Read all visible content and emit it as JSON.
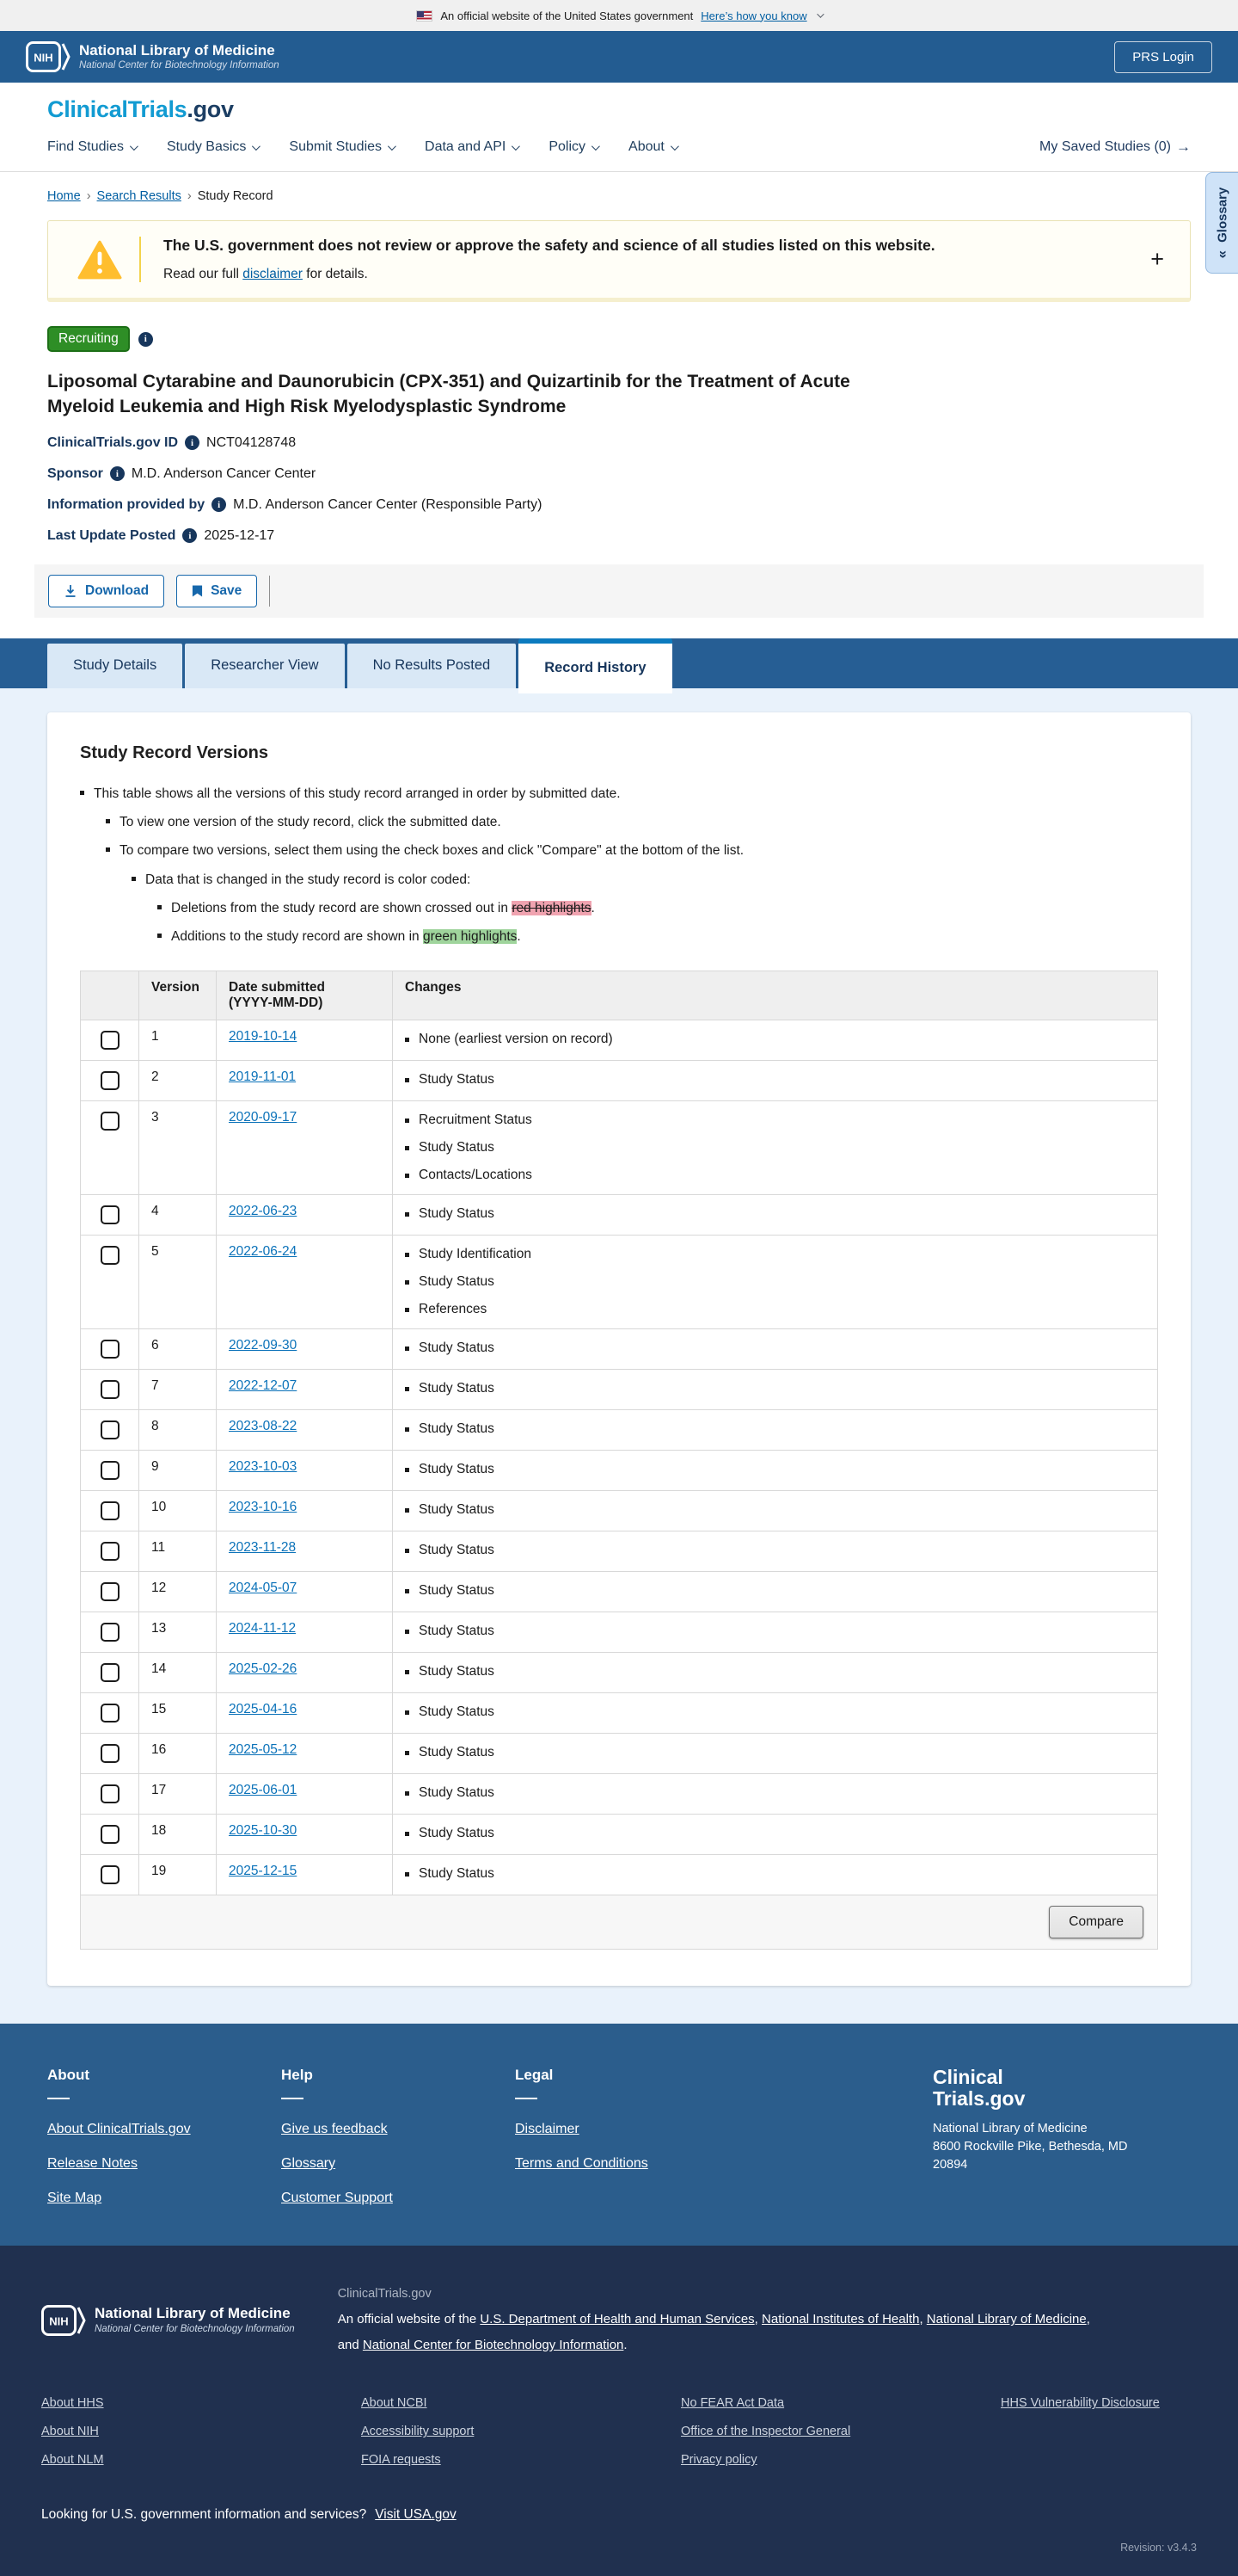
{
  "banner": {
    "text": "An official website of the United States government",
    "link": "Here’s how you know"
  },
  "header": {
    "nih_acronym": "NIH",
    "org": "National Library of Medicine",
    "org_sub": "National Center for Biotechnology Information",
    "login_button": "PRS Login"
  },
  "nav": {
    "logo_primary": "ClinicalTrials",
    "logo_suffix": ".gov",
    "items": [
      {
        "label": "Find Studies"
      },
      {
        "label": "Study Basics"
      },
      {
        "label": "Submit Studies"
      },
      {
        "label": "Data and API"
      },
      {
        "label": "Policy"
      },
      {
        "label": "About"
      }
    ],
    "saved": "My Saved Studies (0)"
  },
  "breadcrumb": {
    "items": [
      "Home",
      "Search Results",
      "Study Record"
    ]
  },
  "glossary": {
    "label": "Glossary"
  },
  "warning": {
    "title": "The U.S. government does not review or approve the safety and science of all studies listed on this website.",
    "body_prefix": "Read our full ",
    "link": "disclaimer",
    "body_suffix": " for details."
  },
  "study": {
    "status": "Recruiting",
    "title": "Liposomal Cytarabine and Daunorubicin (CPX-351) and Quizartinib for the Treatment of Acute Myeloid Leukemia and High Risk Myelodysplastic Syndrome",
    "fields": [
      {
        "label": "ClinicalTrials.gov ID",
        "value": "NCT04128748"
      },
      {
        "label": "Sponsor",
        "value": "M.D. Anderson Cancer Center"
      },
      {
        "label": "Information provided by",
        "value": "M.D. Anderson Cancer Center (Responsible Party)"
      },
      {
        "label": "Last Update Posted",
        "value": "2025-12-17"
      }
    ],
    "actions": {
      "download": "Download",
      "save": "Save"
    }
  },
  "tabs": [
    {
      "label": "Study Details",
      "active": false
    },
    {
      "label": "Researcher View",
      "active": false
    },
    {
      "label": "No Results Posted",
      "active": false
    },
    {
      "label": "Record History",
      "active": true
    }
  ],
  "record_history": {
    "heading": "Study Record Versions",
    "notes": {
      "line1": "This table shows all the versions of this study record arranged in order by submitted date.",
      "line2": "To view one version of the study record, click the submitted date.",
      "line3": "To compare two versions, select them using the check boxes and click \"Compare\" at the bottom of the list.",
      "line4": "Data that is changed in the study record is color coded:",
      "line5_prefix": "Deletions from the study record are shown crossed out in ",
      "line5_highlight": "red highlights",
      "line5_suffix": ".",
      "line6_prefix": "Additions to the study record are shown in ",
      "line6_highlight": "green highlights",
      "line6_suffix": "."
    },
    "table": {
      "col_version": "Version",
      "col_date_line1": "Date submitted",
      "col_date_line2": "(YYYY-MM-DD)",
      "col_changes": "Changes",
      "compare_label": "Compare",
      "rows": [
        {
          "version": "1",
          "date": "2019-10-14",
          "changes": [
            "None (earliest version on record)"
          ]
        },
        {
          "version": "2",
          "date": "2019-11-01",
          "changes": [
            "Study Status"
          ]
        },
        {
          "version": "3",
          "date": "2020-09-17",
          "changes": [
            "Recruitment Status",
            "Study Status",
            "Contacts/Locations"
          ]
        },
        {
          "version": "4",
          "date": "2022-06-23",
          "changes": [
            "Study Status"
          ]
        },
        {
          "version": "5",
          "date": "2022-06-24",
          "changes": [
            "Study Identification",
            "Study Status",
            "References"
          ]
        },
        {
          "version": "6",
          "date": "2022-09-30",
          "changes": [
            "Study Status"
          ]
        },
        {
          "version": "7",
          "date": "2022-12-07",
          "changes": [
            "Study Status"
          ]
        },
        {
          "version": "8",
          "date": "2023-08-22",
          "changes": [
            "Study Status"
          ]
        },
        {
          "version": "9",
          "date": "2023-10-03",
          "changes": [
            "Study Status"
          ]
        },
        {
          "version": "10",
          "date": "2023-10-16",
          "changes": [
            "Study Status"
          ]
        },
        {
          "version": "11",
          "date": "2023-11-28",
          "changes": [
            "Study Status"
          ]
        },
        {
          "version": "12",
          "date": "2024-05-07",
          "changes": [
            "Study Status"
          ]
        },
        {
          "version": "13",
          "date": "2024-11-12",
          "changes": [
            "Study Status"
          ]
        },
        {
          "version": "14",
          "date": "2025-02-26",
          "changes": [
            "Study Status"
          ]
        },
        {
          "version": "15",
          "date": "2025-04-16",
          "changes": [
            "Study Status"
          ]
        },
        {
          "version": "16",
          "date": "2025-05-12",
          "changes": [
            "Study Status"
          ]
        },
        {
          "version": "17",
          "date": "2025-06-01",
          "changes": [
            "Study Status"
          ]
        },
        {
          "version": "18",
          "date": "2025-10-30",
          "changes": [
            "Study Status"
          ]
        },
        {
          "version": "19",
          "date": "2025-12-15",
          "changes": [
            "Study Status"
          ]
        }
      ]
    }
  },
  "footer": {
    "columns": [
      {
        "heading": "About",
        "links": [
          "About ClinicalTrials.gov",
          "Release Notes",
          "Site Map"
        ]
      },
      {
        "heading": "Help",
        "links": [
          "Give us feedback",
          "Glossary",
          "Customer Support"
        ]
      },
      {
        "heading": "Legal",
        "links": [
          "Disclaimer",
          "Terms and Conditions"
        ]
      }
    ],
    "brand_line1": "Clinical",
    "brand_line2": "Trials.gov",
    "org": "National Library of Medicine",
    "address1": "8600 Rockville Pike, Bethesda, MD",
    "address2": "20894"
  },
  "subfooter": {
    "nih_acronym": "NIH",
    "org": "National Library of Medicine",
    "org_sub": "National Center for Biotechnology Information",
    "site": "ClinicalTrials.gov",
    "official_prefix": "An official website of the ",
    "official_links": [
      "U.S. Department of Health and Human Services",
      "National Institutes of Health",
      "National Library of Medicine",
      "National Center for Biotechnology Information"
    ],
    "link_columns": [
      [
        "About HHS",
        "About NIH",
        "About NLM"
      ],
      [
        "About NCBI",
        "Accessibility support",
        "FOIA requests"
      ],
      [
        "No FEAR Act Data",
        "Office of the Inspector General",
        "Privacy policy"
      ],
      [
        "HHS Vulnerability Disclosure"
      ]
    ],
    "usa_prompt": "Looking for U.S. government information and services?",
    "usa_link": "Visit USA.gov",
    "revision": "Revision: v3.4.3"
  },
  "colors": {
    "header_blue": "#235c91",
    "tab_band_blue": "#265e94",
    "active_tab_accent": "#0c7bbf",
    "recruiting_green": "#2e8e26",
    "footer_blue": "#2b5d8c",
    "footer_dark": "#20304f",
    "link_blue": "#005ea2",
    "red_highlight": "#f0a3b0",
    "green_highlight": "#9fd49c"
  }
}
